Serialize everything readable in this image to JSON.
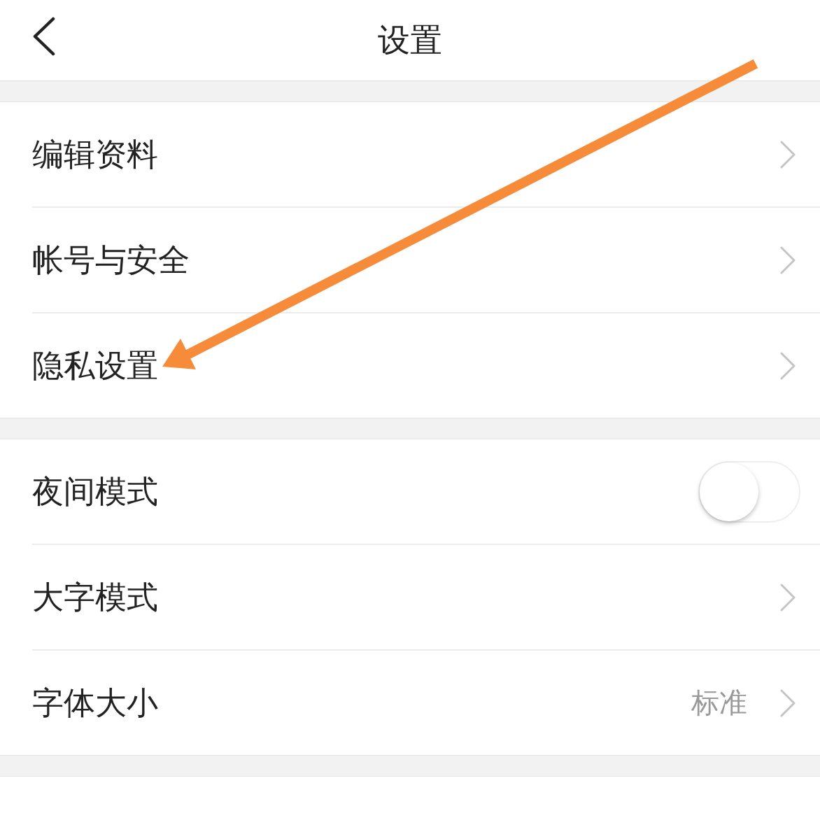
{
  "header": {
    "title": "设置"
  },
  "sections": [
    {
      "items": [
        {
          "kind": "link",
          "label": "编辑资料"
        },
        {
          "kind": "link",
          "label": "帐号与安全"
        },
        {
          "kind": "link",
          "label": "隐私设置"
        }
      ]
    },
    {
      "items": [
        {
          "kind": "toggle",
          "label": "夜间模式",
          "on": false
        },
        {
          "kind": "link",
          "label": "大字模式"
        },
        {
          "kind": "value",
          "label": "字体大小",
          "value": "标准"
        }
      ]
    }
  ]
}
